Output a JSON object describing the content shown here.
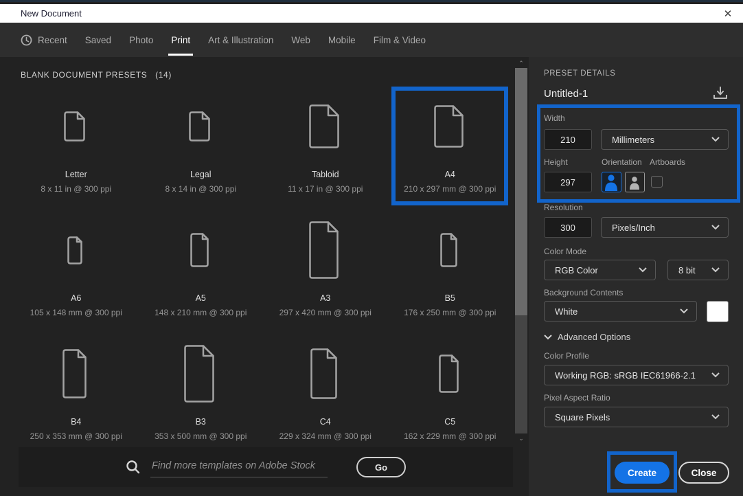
{
  "window": {
    "title": "New Document",
    "close_glyph": "✕"
  },
  "tabs": {
    "active": "Print",
    "items": [
      {
        "label": "Recent",
        "icon": "clock"
      },
      {
        "label": "Saved"
      },
      {
        "label": "Photo"
      },
      {
        "label": "Print"
      },
      {
        "label": "Art & Illustration"
      },
      {
        "label": "Web"
      },
      {
        "label": "Mobile"
      },
      {
        "label": "Film & Video"
      }
    ]
  },
  "presets": {
    "heading": "BLANK DOCUMENT PRESETS",
    "count": "(14)",
    "items": [
      {
        "name": "Letter",
        "dims": "8 x 11 in @ 300 ppi",
        "iw": 33,
        "ih": 46,
        "selected": false
      },
      {
        "name": "Legal",
        "dims": "8 x 14 in @ 300 ppi",
        "iw": 33,
        "ih": 46,
        "selected": false
      },
      {
        "name": "Tabloid",
        "dims": "11 x 17 in @ 300 ppi",
        "iw": 46,
        "ih": 66,
        "selected": false
      },
      {
        "name": "A4",
        "dims": "210 x 297 mm @ 300 ppi",
        "iw": 45,
        "ih": 64,
        "selected": true
      },
      {
        "name": "A6",
        "dims": "105 x 148 mm @ 300 ppi",
        "iw": 24,
        "ih": 43,
        "selected": false
      },
      {
        "name": "A5",
        "dims": "148 x 210 mm @ 300 ppi",
        "iw": 29,
        "ih": 52,
        "selected": false
      },
      {
        "name": "A3",
        "dims": "297 x 420 mm @ 300 ppi",
        "iw": 45,
        "ih": 86,
        "selected": false
      },
      {
        "name": "B5",
        "dims": "176 x 250 mm @ 300 ppi",
        "iw": 27,
        "ih": 52,
        "selected": false
      },
      {
        "name": "B4",
        "dims": "250 x 353 mm @ 300 ppi",
        "iw": 37,
        "ih": 74,
        "selected": false
      },
      {
        "name": "B3",
        "dims": "353 x 500 mm @ 300 ppi",
        "iw": 46,
        "ih": 86,
        "selected": false
      },
      {
        "name": "C4",
        "dims": "229 x 324 mm @ 300 ppi",
        "iw": 41,
        "ih": 76,
        "selected": false
      },
      {
        "name": "C5",
        "dims": "162 x 229 mm @ 300 ppi",
        "iw": 31,
        "ih": 58,
        "selected": false
      }
    ]
  },
  "search": {
    "placeholder": "Find more templates on Adobe Stock",
    "go_label": "Go"
  },
  "details": {
    "heading": "PRESET DETAILS",
    "doc_name": "Untitled-1",
    "width": {
      "label": "Width",
      "value": "210",
      "unit": "Millimeters"
    },
    "height": {
      "label": "Height",
      "value": "297"
    },
    "orientation_label": "Orientation",
    "artboards_label": "Artboards",
    "resolution": {
      "label": "Resolution",
      "value": "300",
      "unit": "Pixels/Inch"
    },
    "color_mode": {
      "label": "Color Mode",
      "value": "RGB Color",
      "bit_depth": "8 bit"
    },
    "background": {
      "label": "Background Contents",
      "value": "White",
      "swatch_color": "#ffffff"
    },
    "advanced_label": "Advanced Options",
    "color_profile": {
      "label": "Color Profile",
      "value": "Working RGB: sRGB IEC61966-2.1"
    },
    "pixel_aspect": {
      "label": "Pixel Aspect Ratio",
      "value": "Square Pixels"
    }
  },
  "actions": {
    "create": "Create",
    "close": "Close"
  },
  "colors": {
    "accent": "#1473e6",
    "annotation": "#1264cb"
  }
}
